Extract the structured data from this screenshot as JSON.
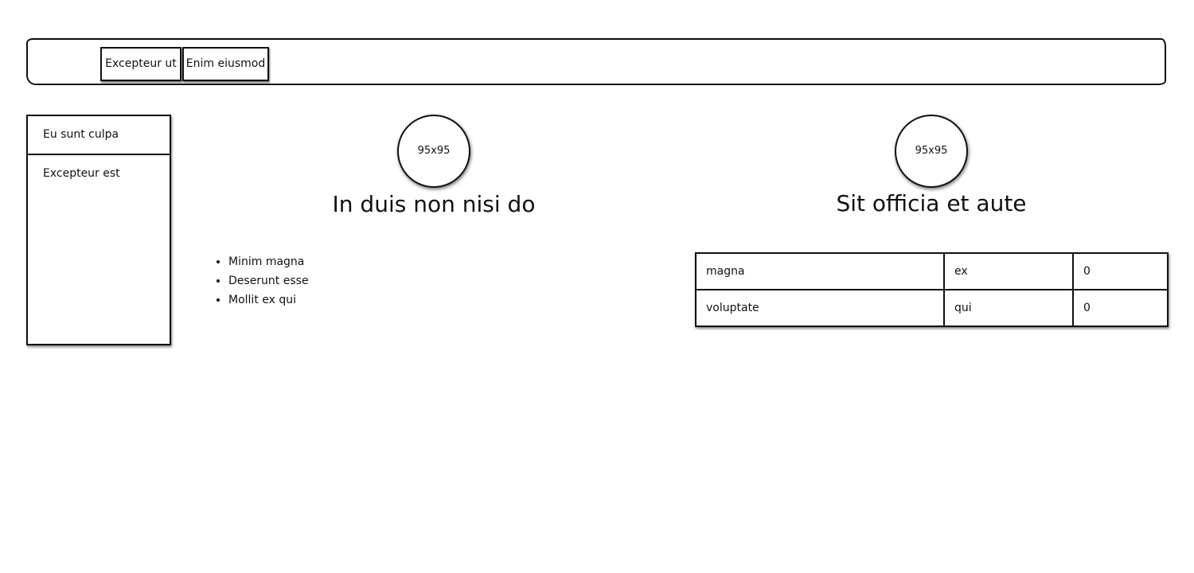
{
  "navbar": {
    "buttons": [
      {
        "label": "Excepteur ut"
      },
      {
        "label": "Enim eiusmod"
      }
    ]
  },
  "sidebar": {
    "items": [
      {
        "label": "Eu sunt culpa"
      },
      {
        "label": "Excepteur est"
      }
    ]
  },
  "left_panel": {
    "avatar_text": "95x95",
    "heading": "In duis non nisi do",
    "list": [
      "Minim magna",
      "Deserunt esse",
      "Mollit ex qui"
    ]
  },
  "right_panel": {
    "avatar_text": "95x95",
    "heading": "Sit officia et aute",
    "table": {
      "rows": [
        [
          "magna",
          "ex",
          "0"
        ],
        [
          "voluptate",
          "qui",
          "0"
        ]
      ]
    }
  }
}
